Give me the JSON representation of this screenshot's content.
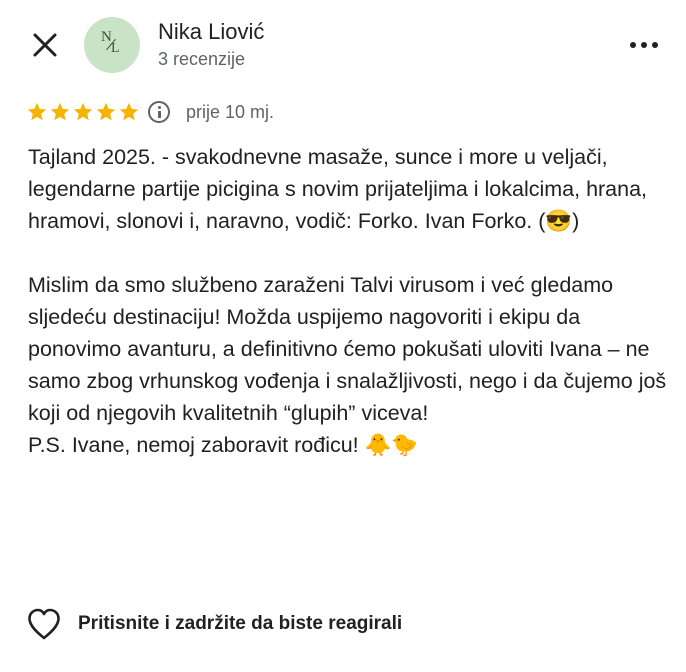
{
  "header": {
    "close_icon": "close-icon",
    "avatar_initials_top": "N",
    "avatar_initials_bottom": "L",
    "avatar_color": "#c9e3c6",
    "user_name": "Nika Liović",
    "review_count": "3 recenzije",
    "more_icon": "more-horizontal-icon"
  },
  "rating": {
    "stars": 5,
    "star_color": "#f4b400",
    "info_icon": "info-icon",
    "time": "prije 10 mj."
  },
  "review": {
    "text": "Tajland 2025. - svakodnevne masaže, sunce i more u veljači, legendarne partije picigina s novim prijateljima i lokalcima, hrana, hramovi, slonovi i, naravno, vodič: Forko. Ivan Forko. (😎)\n\nMislim da smo službeno zaraženi Talvi virusom i već gledamo sljedeću destinaciju! Možda uspijemo nagovoriti i ekipu da ponovimo avanturu, a definitivno ćemo pokušati uloviti Ivana – ne samo zbog vrhunskog vođenja i snalažljivosti, nego i da čujemo još koji od njegovih kvalitetnih “glupih” viceva!\nP.S. Ivane, nemoj zaboravit rođicu! 🐥🐤"
  },
  "reaction": {
    "icon": "heart-outline-icon",
    "label": "Pritisnite i zadržite da biste reagirali"
  }
}
